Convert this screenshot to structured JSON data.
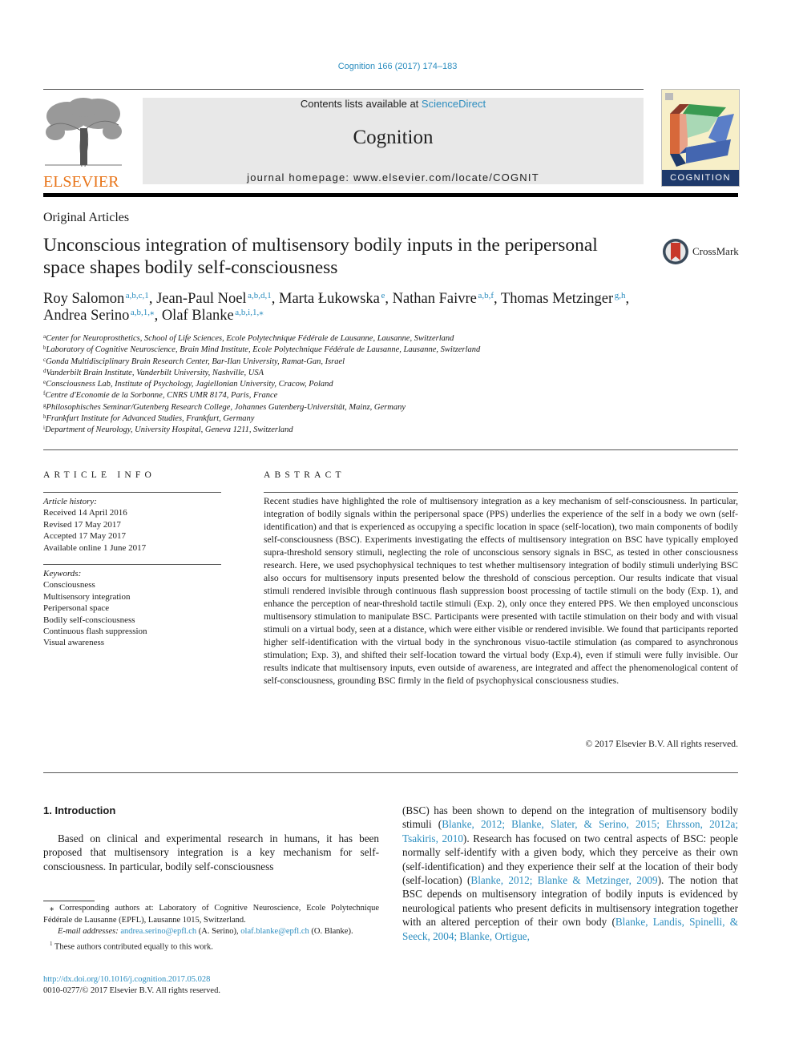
{
  "header": {
    "journal_ref": "Cognition 166 (2017) 174–183",
    "contents_prefix": "Contents lists available at ",
    "contents_link": "ScienceDirect",
    "journal_name": "Cognition",
    "homepage": "journal homepage: www.elsevier.com/locate/COGNIT",
    "publisher_logo_text": "ELSEVIER",
    "cover_label": "COGNITION"
  },
  "article": {
    "section": "Original Articles",
    "title": "Unconscious integration of multisensory bodily inputs in the peripersonal space shapes bodily self-consciousness",
    "crossmark_label": "CrossMark",
    "authors": [
      {
        "name": "Roy Salomon",
        "sup": "a,b,c,1"
      },
      {
        "name": "Jean-Paul Noel",
        "sup": "a,b,d,1"
      },
      {
        "name": "Marta Łukowska",
        "sup": "e"
      },
      {
        "name": "Nathan Faivre",
        "sup": "a,b,f"
      },
      {
        "name": "Thomas Metzinger",
        "sup": "g,h"
      },
      {
        "name": "Andrea Serino",
        "sup": "a,b,1,⁎"
      },
      {
        "name": "Olaf Blanke",
        "sup": "a,b,i,1,⁎"
      }
    ],
    "affiliations": [
      {
        "key": "a",
        "text": "Center for Neuroprosthetics, School of Life Sciences, Ecole Polytechnique Fédérale de Lausanne, Lausanne, Switzerland"
      },
      {
        "key": "b",
        "text": "Laboratory of Cognitive Neuroscience, Brain Mind Institute, Ecole Polytechnique Fédérale de Lausanne, Lausanne, Switzerland"
      },
      {
        "key": "c",
        "text": "Gonda Multidisciplinary Brain Research Center, Bar-Ilan University, Ramat-Gan, Israel"
      },
      {
        "key": "d",
        "text": "Vanderbilt Brain Institute, Vanderbilt University, Nashville, USA"
      },
      {
        "key": "e",
        "text": "Consciousness Lab, Institute of Psychology, Jagiellonian University, Cracow, Poland"
      },
      {
        "key": "f",
        "text": "Centre d'Economie de la Sorbonne, CNRS UMR 8174, Paris, France"
      },
      {
        "key": "g",
        "text": "Philosophisches Seminar/Gutenberg Research College, Johannes Gutenberg-Universität, Mainz, Germany"
      },
      {
        "key": "h",
        "text": "Frankfurt Institute for Advanced Studies, Frankfurt, Germany"
      },
      {
        "key": "i",
        "text": "Department of Neurology, University Hospital, Geneva 1211, Switzerland"
      }
    ]
  },
  "article_info": {
    "heading": "ARTICLE INFO",
    "history_label": "Article history:",
    "history": [
      "Received 14 April 2016",
      "Revised 17 May 2017",
      "Accepted 17 May 2017",
      "Available online 1 June 2017"
    ],
    "keywords_label": "Keywords:",
    "keywords": [
      "Consciousness",
      "Multisensory integration",
      "Peripersonal space",
      "Bodily self-consciousness",
      "Continuous flash suppression",
      "Visual awareness"
    ]
  },
  "abstract": {
    "heading": "ABSTRACT",
    "text": "Recent studies have highlighted the role of multisensory integration as a key mechanism of self-consciousness. In particular, integration of bodily signals within the peripersonal space (PPS) underlies the experience of the self in a body we own (self-identification) and that is experienced as occupying a specific location in space (self-location), two main components of bodily self-consciousness (BSC). Experiments investigating the effects of multisensory integration on BSC have typically employed supra-threshold sensory stimuli, neglecting the role of unconscious sensory signals in BSC, as tested in other consciousness research. Here, we used psychophysical techniques to test whether multisensory integration of bodily stimuli underlying BSC also occurs for multisensory inputs presented below the threshold of conscious perception. Our results indicate that visual stimuli rendered invisible through con­tinuous flash suppression boost processing of tactile stimuli on the body (Exp. 1), and enhance the per­ception of near-threshold tactile stimuli (Exp. 2), only once they entered PPS. We then employed unconscious multisensory stimulation to manipulate BSC. Participants were presented with tactile stim­ulation on their body and with visual stimuli on a virtual body, seen at a distance, which were either vis­ible or rendered invisible. We found that participants reported higher self-identification with the virtual body in the synchronous visuo-tactile stimulation (as compared to asynchronous stimulation; Exp. 3), and shifted their self-location toward the virtual body (Exp.4), even if stimuli were fully invisible. Our results indicate that multisensory inputs, even outside of awareness, are integrated and affect the phe­nomenological content of self-consciousness, grounding BSC firmly in the field of psychophysical con­sciousness studies.",
    "copyright": "© 2017 Elsevier B.V. All rights reserved."
  },
  "introduction": {
    "heading": "1. Introduction",
    "col1_text": "Based on clinical and experimental research in humans, it has been proposed that multisensory integration is a key mechanism for self-consciousness. In particular, bodily self-consciousness",
    "col2": {
      "t1": "(BSC) has been shown to depend on the integration of multisensory bodily stimuli (",
      "c1": "Blanke, 2012; Blanke, Slater, & Serino, 2015; Ehrsson, 2012a; Tsakiris, 2010",
      "t2": "). Research has focused on two cen­tral aspects of BSC: people normally self-identify with a given body, which they perceive as their own (self-identification) and they experience their self at the location of their body (self-location) (",
      "c2": "Blanke, 2012; Blanke & Metzinger, 2009",
      "t3": "). The notion that BSC depends on multisensory integration of bodily inputs is evi­denced by neurological patients who present deficits in multisen­sory integration together with an altered perception of their own body (",
      "c3": "Blanke, Landis, Spinelli, & Seeck, 2004; Blanke, Ortigue,"
    }
  },
  "footnotes": {
    "corresponding": "⁎ Corresponding authors at: Laboratory of Cognitive Neuroscience, Ecole Polytechnique Fédérale de Lausanne (EPFL), Lausanne 1015, Switzerland.",
    "email_label": "E-mail addresses:",
    "email1": "andrea.serino@epfl.ch",
    "email1_who": " (A. Serino), ",
    "email2": "olaf.blanke@epfl.ch",
    "email2_who": " (O. Blanke).",
    "equal_mark": "1",
    "equal": " These authors contributed equally to this work.",
    "doi": "http://dx.doi.org/10.1016/j.cognition.2017.05.028",
    "issn": "0010-0277/© 2017 Elsevier B.V. All rights reserved."
  }
}
